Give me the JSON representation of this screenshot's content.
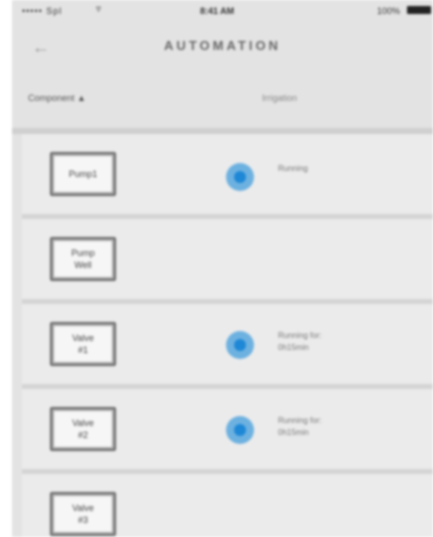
{
  "status_bar": {
    "carrier": "••••• Spl",
    "time": "8:41 AM",
    "battery": "100%"
  },
  "nav": {
    "title": "AUTOMATION"
  },
  "header": {
    "sort_label": "Component ▲",
    "irrigation_label": "Irrigation"
  },
  "rows": [
    {
      "label": "Pump1",
      "status": "Running"
    },
    {
      "label": "Pump\nWell",
      "status": ""
    },
    {
      "label": "Valve\n#1",
      "status": "Running for:\n0h15min"
    },
    {
      "label": "Valve\n#2",
      "status": "Running for:\n0h15min"
    },
    {
      "label": "Valve\n#3",
      "status": ""
    }
  ],
  "colors": {
    "accent": "#1e88d6",
    "background": "#e3e3e3"
  }
}
